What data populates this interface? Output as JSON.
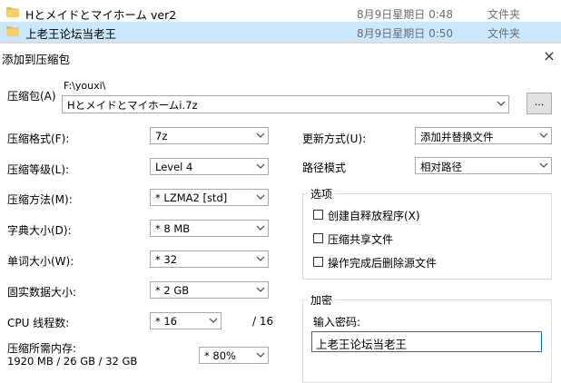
{
  "files": [
    {
      "name": "Hとメイドとマイホーム ver2",
      "date": "8月9日星期日 0:48",
      "type": "文件夹"
    },
    {
      "name": "上老王论坛当老王",
      "date": "8月9日星期日 0:50",
      "type": "文件夹"
    }
  ],
  "dialog": {
    "title": "添加到压缩包",
    "close": "×",
    "archive": {
      "label": "压缩包(A)",
      "path": "F:\\youxi\\",
      "value": "Hとメイドとマイホームi.7z",
      "browse": "..."
    },
    "format": {
      "label": "压缩格式(F):",
      "value": "7z"
    },
    "level": {
      "label": "压缩等级(L):",
      "value": "Level 4"
    },
    "method": {
      "label": "压缩方法(M):",
      "value": "* LZMA2 [std]"
    },
    "dict": {
      "label": "字典大小(D):",
      "value": "* 8 MB"
    },
    "word": {
      "label": "单词大小(W):",
      "value": "* 32"
    },
    "solid": {
      "label": "固实数据大小:",
      "value": "* 2 GB"
    },
    "cpu": {
      "label": "CPU 线程数:",
      "value": "* 16",
      "total": "/ 16"
    },
    "memory": {
      "label": "压缩所需内存:",
      "value": "1920 MB / 26 GB / 32 GB",
      "percent": "* 80%"
    },
    "update": {
      "label": "更新方式(U):",
      "value": "添加并替换文件"
    },
    "pathmode": {
      "label": "路径模式",
      "value": "相对路径"
    },
    "options": {
      "title": "选项",
      "items": [
        "创建自释放程序(X)",
        "压缩共享文件",
        "操作完成后删除源文件"
      ]
    },
    "encrypt": {
      "title": "加密",
      "password_label": "输入密码:",
      "password_value": "上老王论坛当老王"
    }
  },
  "colors": {
    "selection": "#cce8ff",
    "folder": "#e8b84a"
  }
}
